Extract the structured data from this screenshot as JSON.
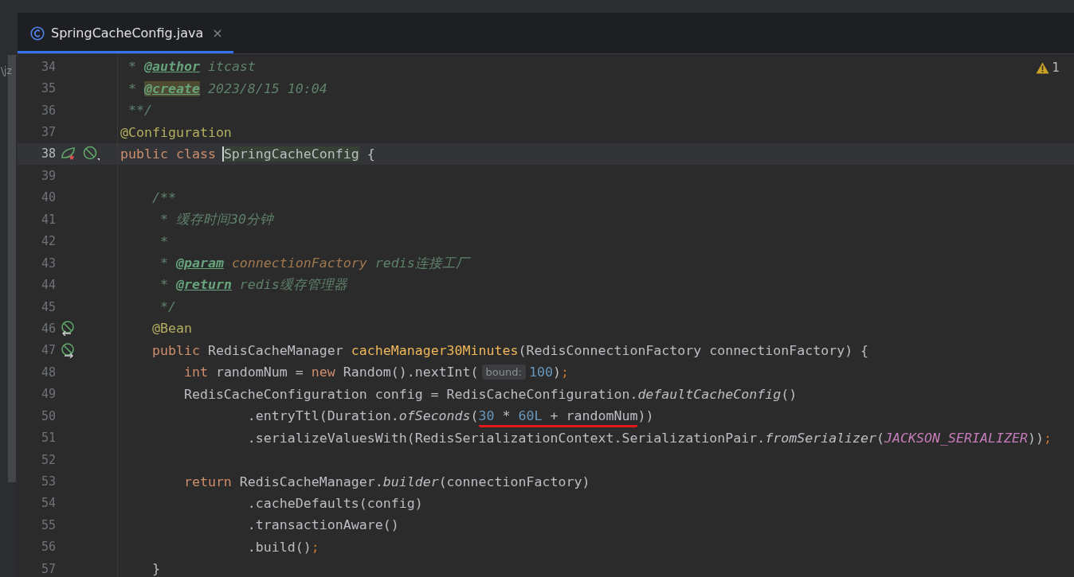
{
  "side_panel_text": "\\jz",
  "tabs": [
    {
      "label": "SpringCacheConfig.java",
      "selected": true,
      "kind": "class"
    }
  ],
  "problems": {
    "warnings": "1"
  },
  "lines": [
    {
      "number": "34",
      "current": false,
      "tokens": [
        {
          "kind": "comment",
          "text": " * "
        },
        {
          "kind": "doctag",
          "text": "@author"
        },
        {
          "kind": "comment",
          "text": " itcast"
        }
      ]
    },
    {
      "number": "35",
      "current": false,
      "tokens": [
        {
          "kind": "comment",
          "text": " * "
        },
        {
          "kind": "doctag-found",
          "text": "@create"
        },
        {
          "kind": "comment",
          "text": " 2023/8/15 10:04"
        }
      ]
    },
    {
      "number": "36",
      "current": false,
      "tokens": [
        {
          "kind": "comment",
          "text": " **/"
        }
      ]
    },
    {
      "number": "37",
      "current": false,
      "tokens": [
        {
          "kind": "annotation",
          "text": "@Configuration"
        }
      ]
    },
    {
      "number": "38",
      "current": true,
      "gutter": [
        {
          "kind": "bean"
        },
        {
          "kind": "slash"
        }
      ],
      "tokens": [
        {
          "kind": "keyword",
          "text": "public class "
        },
        {
          "kind": "caret-usage",
          "text": "SpringCacheConfig"
        },
        {
          "kind": "plain",
          "text": " {"
        }
      ]
    },
    {
      "number": "39",
      "current": false
    },
    {
      "number": "40",
      "current": false,
      "tokens": [
        {
          "kind": "comment",
          "text": "    /**"
        }
      ]
    },
    {
      "number": "41",
      "current": false,
      "tokens": [
        {
          "kind": "comment",
          "text": "     * 缓存时间30分钟"
        }
      ]
    },
    {
      "number": "42",
      "current": false,
      "tokens": [
        {
          "kind": "comment",
          "text": "     *"
        }
      ]
    },
    {
      "number": "43",
      "current": false,
      "tokens": [
        {
          "kind": "comment",
          "text": "     * "
        },
        {
          "kind": "doctag",
          "text": "@param"
        },
        {
          "kind": "docparam",
          "text": " connectionFactory"
        },
        {
          "kind": "comment",
          "text": " redis连接工厂"
        }
      ]
    },
    {
      "number": "44",
      "current": false,
      "tokens": [
        {
          "kind": "comment",
          "text": "     * "
        },
        {
          "kind": "doctag",
          "text": "@return"
        },
        {
          "kind": "comment",
          "text": " redis缓存管理器"
        }
      ]
    },
    {
      "number": "45",
      "current": false,
      "tokens": [
        {
          "kind": "comment",
          "text": "     */"
        }
      ]
    },
    {
      "number": "46",
      "current": false,
      "gutter": [
        {
          "kind": "slash-in"
        }
      ],
      "tokens": [
        {
          "kind": "annotation",
          "text": "    @Bean"
        }
      ]
    },
    {
      "number": "47",
      "current": false,
      "gutter": [
        {
          "kind": "slash-out"
        }
      ],
      "tokens": [
        {
          "kind": "keyword",
          "text": "    public "
        },
        {
          "kind": "plain",
          "text": "RedisCacheManager "
        },
        {
          "kind": "method",
          "text": "cacheManager30Minutes"
        },
        {
          "kind": "plain",
          "text": "(RedisConnectionFactory connectionFactory) {"
        }
      ]
    },
    {
      "number": "48",
      "current": false,
      "tokens": [
        {
          "kind": "keyword",
          "text": "        int "
        },
        {
          "kind": "plain",
          "text": "randomNum = "
        },
        {
          "kind": "keyword",
          "text": "new "
        },
        {
          "kind": "plain",
          "text": "Random().nextInt("
        },
        {
          "kind": "hint",
          "text": "bound:"
        },
        {
          "kind": "number",
          "text": "100"
        },
        {
          "kind": "plain",
          "text": ")"
        },
        {
          "kind": "semi",
          "text": ";"
        }
      ]
    },
    {
      "number": "49",
      "current": false,
      "tokens": [
        {
          "kind": "plain",
          "text": "        RedisCacheConfiguration config = RedisCacheConfiguration."
        },
        {
          "kind": "static",
          "text": "defaultCacheConfig"
        },
        {
          "kind": "plain",
          "text": "()"
        }
      ]
    },
    {
      "number": "50",
      "current": false,
      "tokens": [
        {
          "kind": "plain",
          "text": "                .entryTtl(Duration."
        },
        {
          "kind": "static",
          "text": "ofSeconds"
        },
        {
          "kind": "plain",
          "text": "("
        },
        {
          "kind": "marked",
          "tokens": [
            {
              "kind": "number",
              "text": "30"
            },
            {
              "kind": "plain",
              "text": " * "
            },
            {
              "kind": "number",
              "text": "60L"
            },
            {
              "kind": "plain",
              "text": " + randomNum"
            }
          ]
        },
        {
          "kind": "plain",
          "text": "))"
        }
      ]
    },
    {
      "number": "51",
      "current": false,
      "tokens": [
        {
          "kind": "plain",
          "text": "                .serializeValuesWith(RedisSerializationContext.SerializationPair."
        },
        {
          "kind": "static",
          "text": "fromSerializer"
        },
        {
          "kind": "plain",
          "text": "("
        },
        {
          "kind": "constant",
          "text": "JACKSON_SERIALIZER"
        },
        {
          "kind": "plain",
          "text": "))"
        },
        {
          "kind": "semi",
          "text": ";"
        }
      ]
    },
    {
      "number": "52",
      "current": false
    },
    {
      "number": "53",
      "current": false,
      "tokens": [
        {
          "kind": "keyword",
          "text": "        return "
        },
        {
          "kind": "plain",
          "text": "RedisCacheManager."
        },
        {
          "kind": "static",
          "text": "builder"
        },
        {
          "kind": "plain",
          "text": "(connectionFactory)"
        }
      ]
    },
    {
      "number": "54",
      "current": false,
      "tokens": [
        {
          "kind": "plain",
          "text": "                .cacheDefaults(config)"
        }
      ]
    },
    {
      "number": "55",
      "current": false,
      "tokens": [
        {
          "kind": "plain",
          "text": "                .transactionAware()"
        }
      ]
    },
    {
      "number": "56",
      "current": false,
      "tokens": [
        {
          "kind": "plain",
          "text": "                .build()"
        },
        {
          "kind": "semi",
          "text": ";"
        }
      ]
    },
    {
      "number": "57",
      "current": false,
      "tokens": [
        {
          "kind": "plain",
          "text": "    }"
        }
      ]
    }
  ]
}
